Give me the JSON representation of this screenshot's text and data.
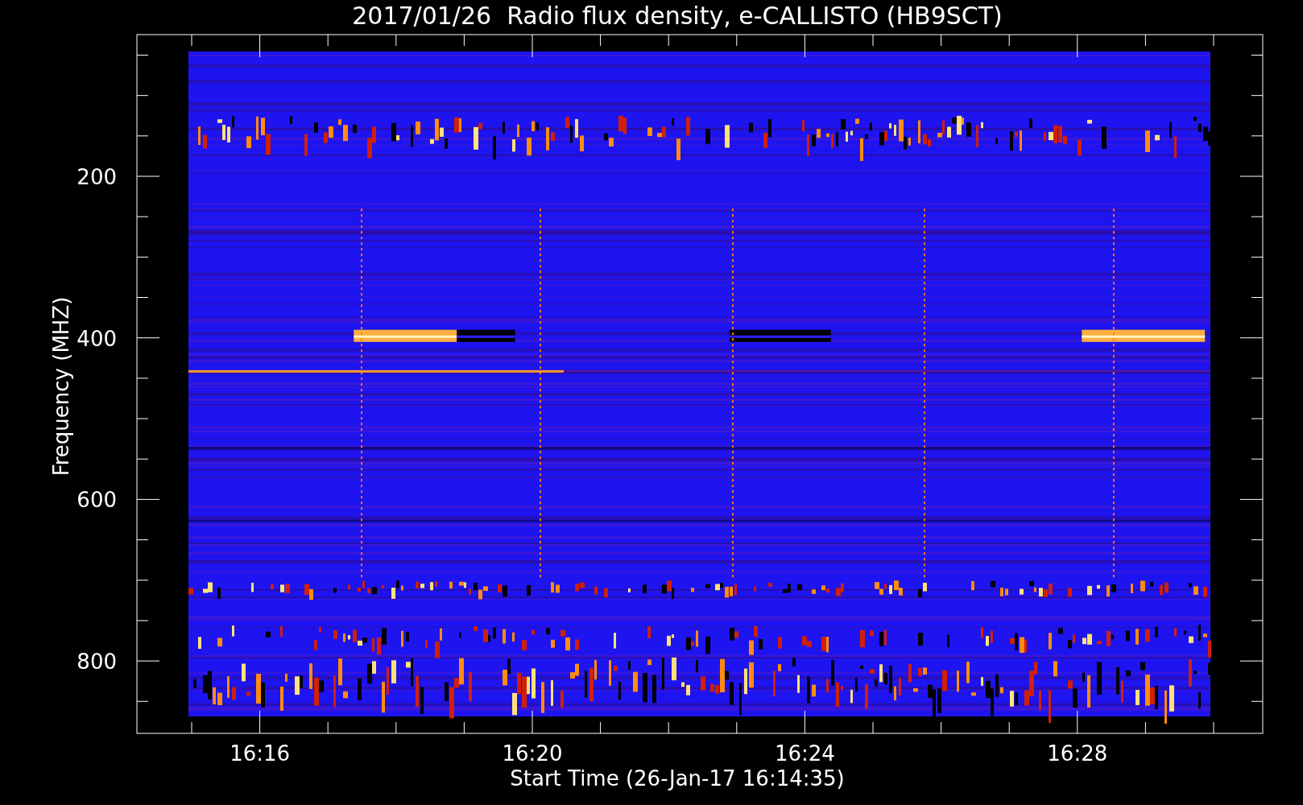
{
  "title": "2017/01/26  Radio flux density, e-CALLISTO (HB9SCT)",
  "y_axis": {
    "label": "Frequency (MHZ)",
    "ticks": [
      "200",
      "400",
      "600",
      "800"
    ]
  },
  "x_axis": {
    "label": "Start Time (26-Jan-17 16:14:35)",
    "ticks": [
      "16:16",
      "16:20",
      "16:24",
      "16:28"
    ]
  }
}
